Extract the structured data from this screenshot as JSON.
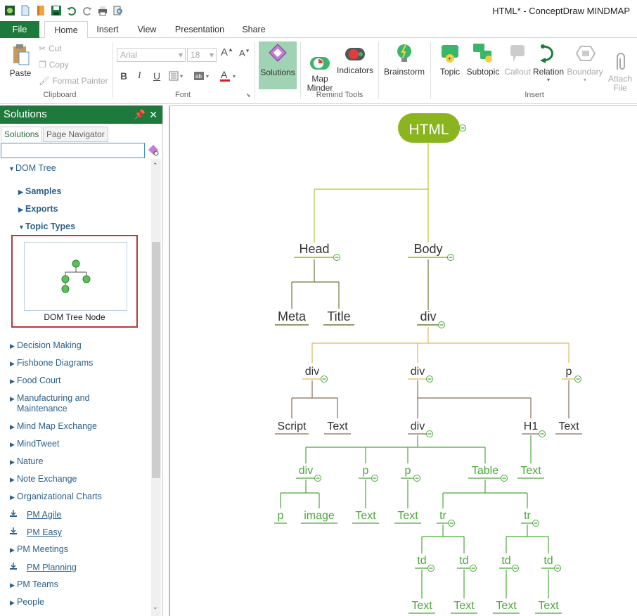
{
  "app": {
    "title": "HTML* - ConceptDraw MINDMAP"
  },
  "tabs": {
    "file": "File",
    "items": [
      "Home",
      "Insert",
      "View",
      "Presentation",
      "Share"
    ]
  },
  "ribbon": {
    "clipboard": {
      "paste": "Paste",
      "cut": "Cut",
      "copy": "Copy",
      "format_painter": "Format Painter",
      "label": "Clipboard"
    },
    "font": {
      "family": "Arial",
      "size": "18",
      "label": "Font",
      "bold": "B",
      "italic": "I",
      "underline": "U"
    },
    "solutions": {
      "label": "Solutions"
    },
    "remind": {
      "map_minder": "Map\nMinder",
      "indicators": "Indicators",
      "label": "Remind Tools"
    },
    "brainstorm": {
      "label": "Brainstorm"
    },
    "insert": {
      "topic": "Topic",
      "subtopic": "Subtopic",
      "callout": "Callout",
      "relation": "Relation",
      "boundary": "Boundary",
      "attach": "Attach\nFile",
      "label": "Insert"
    }
  },
  "solutions_panel": {
    "title": "Solutions",
    "tabs": [
      "Solutions",
      "Page Navigator"
    ],
    "search_value": "",
    "dom_tree": "DOM Tree",
    "sub_items": [
      "Samples",
      "Exports",
      "Topic Types"
    ],
    "card_caption": "DOM Tree Node",
    "items": [
      {
        "label": "Decision Making",
        "kind": "tri"
      },
      {
        "label": "Fishbone Diagrams",
        "kind": "tri"
      },
      {
        "label": "Food Court",
        "kind": "tri"
      },
      {
        "label": "Manufacturing and\nMaintenance",
        "kind": "tri"
      },
      {
        "label": "Mind Map Exchange",
        "kind": "tri"
      },
      {
        "label": "MindTweet",
        "kind": "tri"
      },
      {
        "label": "Nature",
        "kind": "tri"
      },
      {
        "label": "Note Exchange",
        "kind": "tri"
      },
      {
        "label": "Organizational Charts",
        "kind": "tri"
      },
      {
        "label": "PM Agile",
        "kind": "download"
      },
      {
        "label": "PM Easy",
        "kind": "download"
      },
      {
        "label": "PM Meetings",
        "kind": "tri"
      },
      {
        "label": "PM Planning",
        "kind": "download"
      },
      {
        "label": "PM Teams",
        "kind": "tri"
      },
      {
        "label": "People",
        "kind": "tri"
      }
    ]
  },
  "mindmap": {
    "root": "HTML",
    "labels": {
      "head": "Head",
      "body": "Body",
      "meta": "Meta",
      "title": "Title",
      "div_main": "div",
      "div_a": "div",
      "div_b": "div",
      "p_a": "p",
      "script": "Script",
      "text_a": "Text",
      "div_c": "div",
      "h1": "H1",
      "text_b": "Text",
      "div_d": "div",
      "p_b": "p",
      "p_c": "p",
      "table": "Table",
      "text_c": "Text",
      "p_d": "p",
      "image": "image",
      "text_d": "Text",
      "text_e": "Text",
      "tr_a": "tr",
      "tr_b": "tr",
      "td_a": "td",
      "td_b": "td",
      "td_c": "td",
      "td_d": "td",
      "text_f": "Text",
      "text_g": "Text",
      "text_h": "Text",
      "text_i": "Text"
    }
  },
  "colors": {
    "brand_green": "#1e7a3c",
    "root_fill": "#8ab51e",
    "level1_line": "#b5c92b",
    "level2_line": "#6b7b3a",
    "level3_line": "#e3b65e",
    "leaf_green": "#4aa83a",
    "highlight_border": "#b83a3a"
  }
}
